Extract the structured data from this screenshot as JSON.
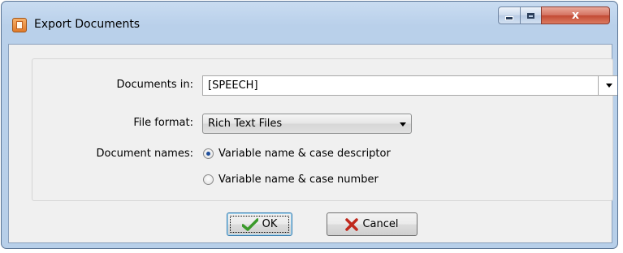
{
  "window": {
    "title": "Export Documents",
    "close_glyph": "x"
  },
  "form": {
    "documents_in_label": "Documents in:",
    "documents_in_value": "[SPEECH]",
    "file_format_label": "File format:",
    "file_format_value": "Rich Text Files",
    "document_names_label": "Document names:",
    "radio_options": [
      {
        "label": "Variable name & case descriptor",
        "checked": true
      },
      {
        "label": "Variable name & case number",
        "checked": false
      }
    ]
  },
  "buttons": {
    "ok_label": "OK",
    "cancel_label": "Cancel"
  },
  "colors": {
    "ok_check": "#3a9a2a",
    "cancel_x": "#c0281c"
  }
}
